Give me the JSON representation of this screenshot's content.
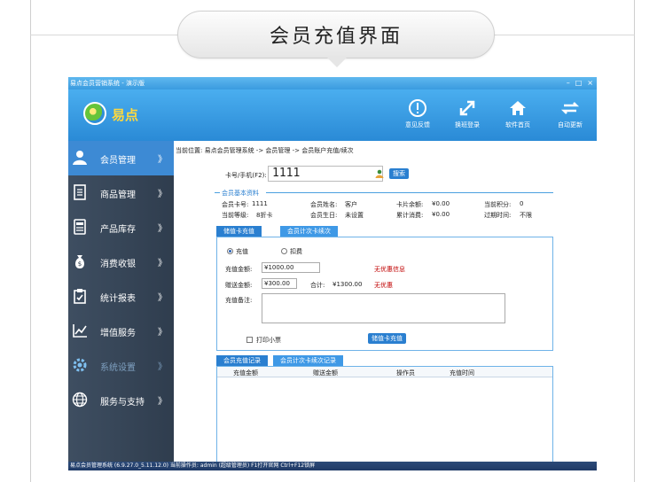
{
  "banner": {
    "title": "会员充值界面"
  },
  "window": {
    "title": "易点会员营销系统 - 演示版",
    "controls": {
      "minimize": "–",
      "maximize": "□",
      "close": "×"
    }
  },
  "header": {
    "logo_text": "易点",
    "toolbar": [
      {
        "label": "意见反馈",
        "icon": "info-icon"
      },
      {
        "label": "换班登录",
        "icon": "swap-arrows-icon"
      },
      {
        "label": "软件首页",
        "icon": "home-icon"
      },
      {
        "label": "自动更新",
        "icon": "refresh-icon"
      }
    ]
  },
  "sidebar": {
    "items": [
      {
        "label": "会员管理",
        "icon": "member-icon",
        "active": true
      },
      {
        "label": "商品管理",
        "icon": "document-icon"
      },
      {
        "label": "产品库存",
        "icon": "inventory-icon"
      },
      {
        "label": "消费收银",
        "icon": "money-bag-icon"
      },
      {
        "label": "统计报表",
        "icon": "clipboard-icon"
      },
      {
        "label": "增值服务",
        "icon": "chart-icon"
      },
      {
        "label": "系统设置",
        "icon": "gear-icon",
        "faded": true
      },
      {
        "label": "服务与支持",
        "icon": "globe-icon"
      }
    ],
    "chevron": "》"
  },
  "breadcrumb": "当前位置: 易点会员管理系统 -> 会员管理 -> 会员账户充值/续次",
  "search": {
    "label": "卡号/手机(F2):",
    "value": "1111",
    "button": "搜索"
  },
  "member_info": {
    "section_title": "会员基本资料",
    "fields": [
      {
        "label": "会员卡号:",
        "value": "1111"
      },
      {
        "label": "会员姓名:",
        "value": "客户"
      },
      {
        "label": "卡片余额:",
        "value": "¥0.00"
      },
      {
        "label": "当前积分:",
        "value": "0"
      },
      {
        "label": "当前等级:",
        "value": "8折卡"
      },
      {
        "label": "会员生日:",
        "value": "未设置"
      },
      {
        "label": "累计消费:",
        "value": "¥0.00"
      },
      {
        "label": "过期时间:",
        "value": "不限"
      }
    ]
  },
  "recharge_tabs": [
    "储值卡充值",
    "会员计次卡续次"
  ],
  "recharge_form": {
    "mode_options": [
      "充值",
      "扣费"
    ],
    "amount_label": "充值金额:",
    "amount_value": "¥1000.00",
    "amount_note": "无优惠信息",
    "gift_label": "赠送金额:",
    "gift_value": "¥300.00",
    "total_label": "合计:",
    "total_value": "¥1300.00",
    "gift_note": "无优惠",
    "remark_label": "充值备注:",
    "print_label": "打印小票",
    "submit_button": "储值卡充值"
  },
  "record_tabs": [
    "会员充值记录",
    "会员计次卡续次记录"
  ],
  "records_table": {
    "columns": [
      "充值金额",
      "赠送金额",
      "操作员",
      "充值时间"
    ]
  },
  "status_bar": "易点会员管理系统 (6.9.27.0_5.11.12.0)  当前操作员: admin (超级管理员)  F1打开官网 Ctrl+F12锁屏"
}
